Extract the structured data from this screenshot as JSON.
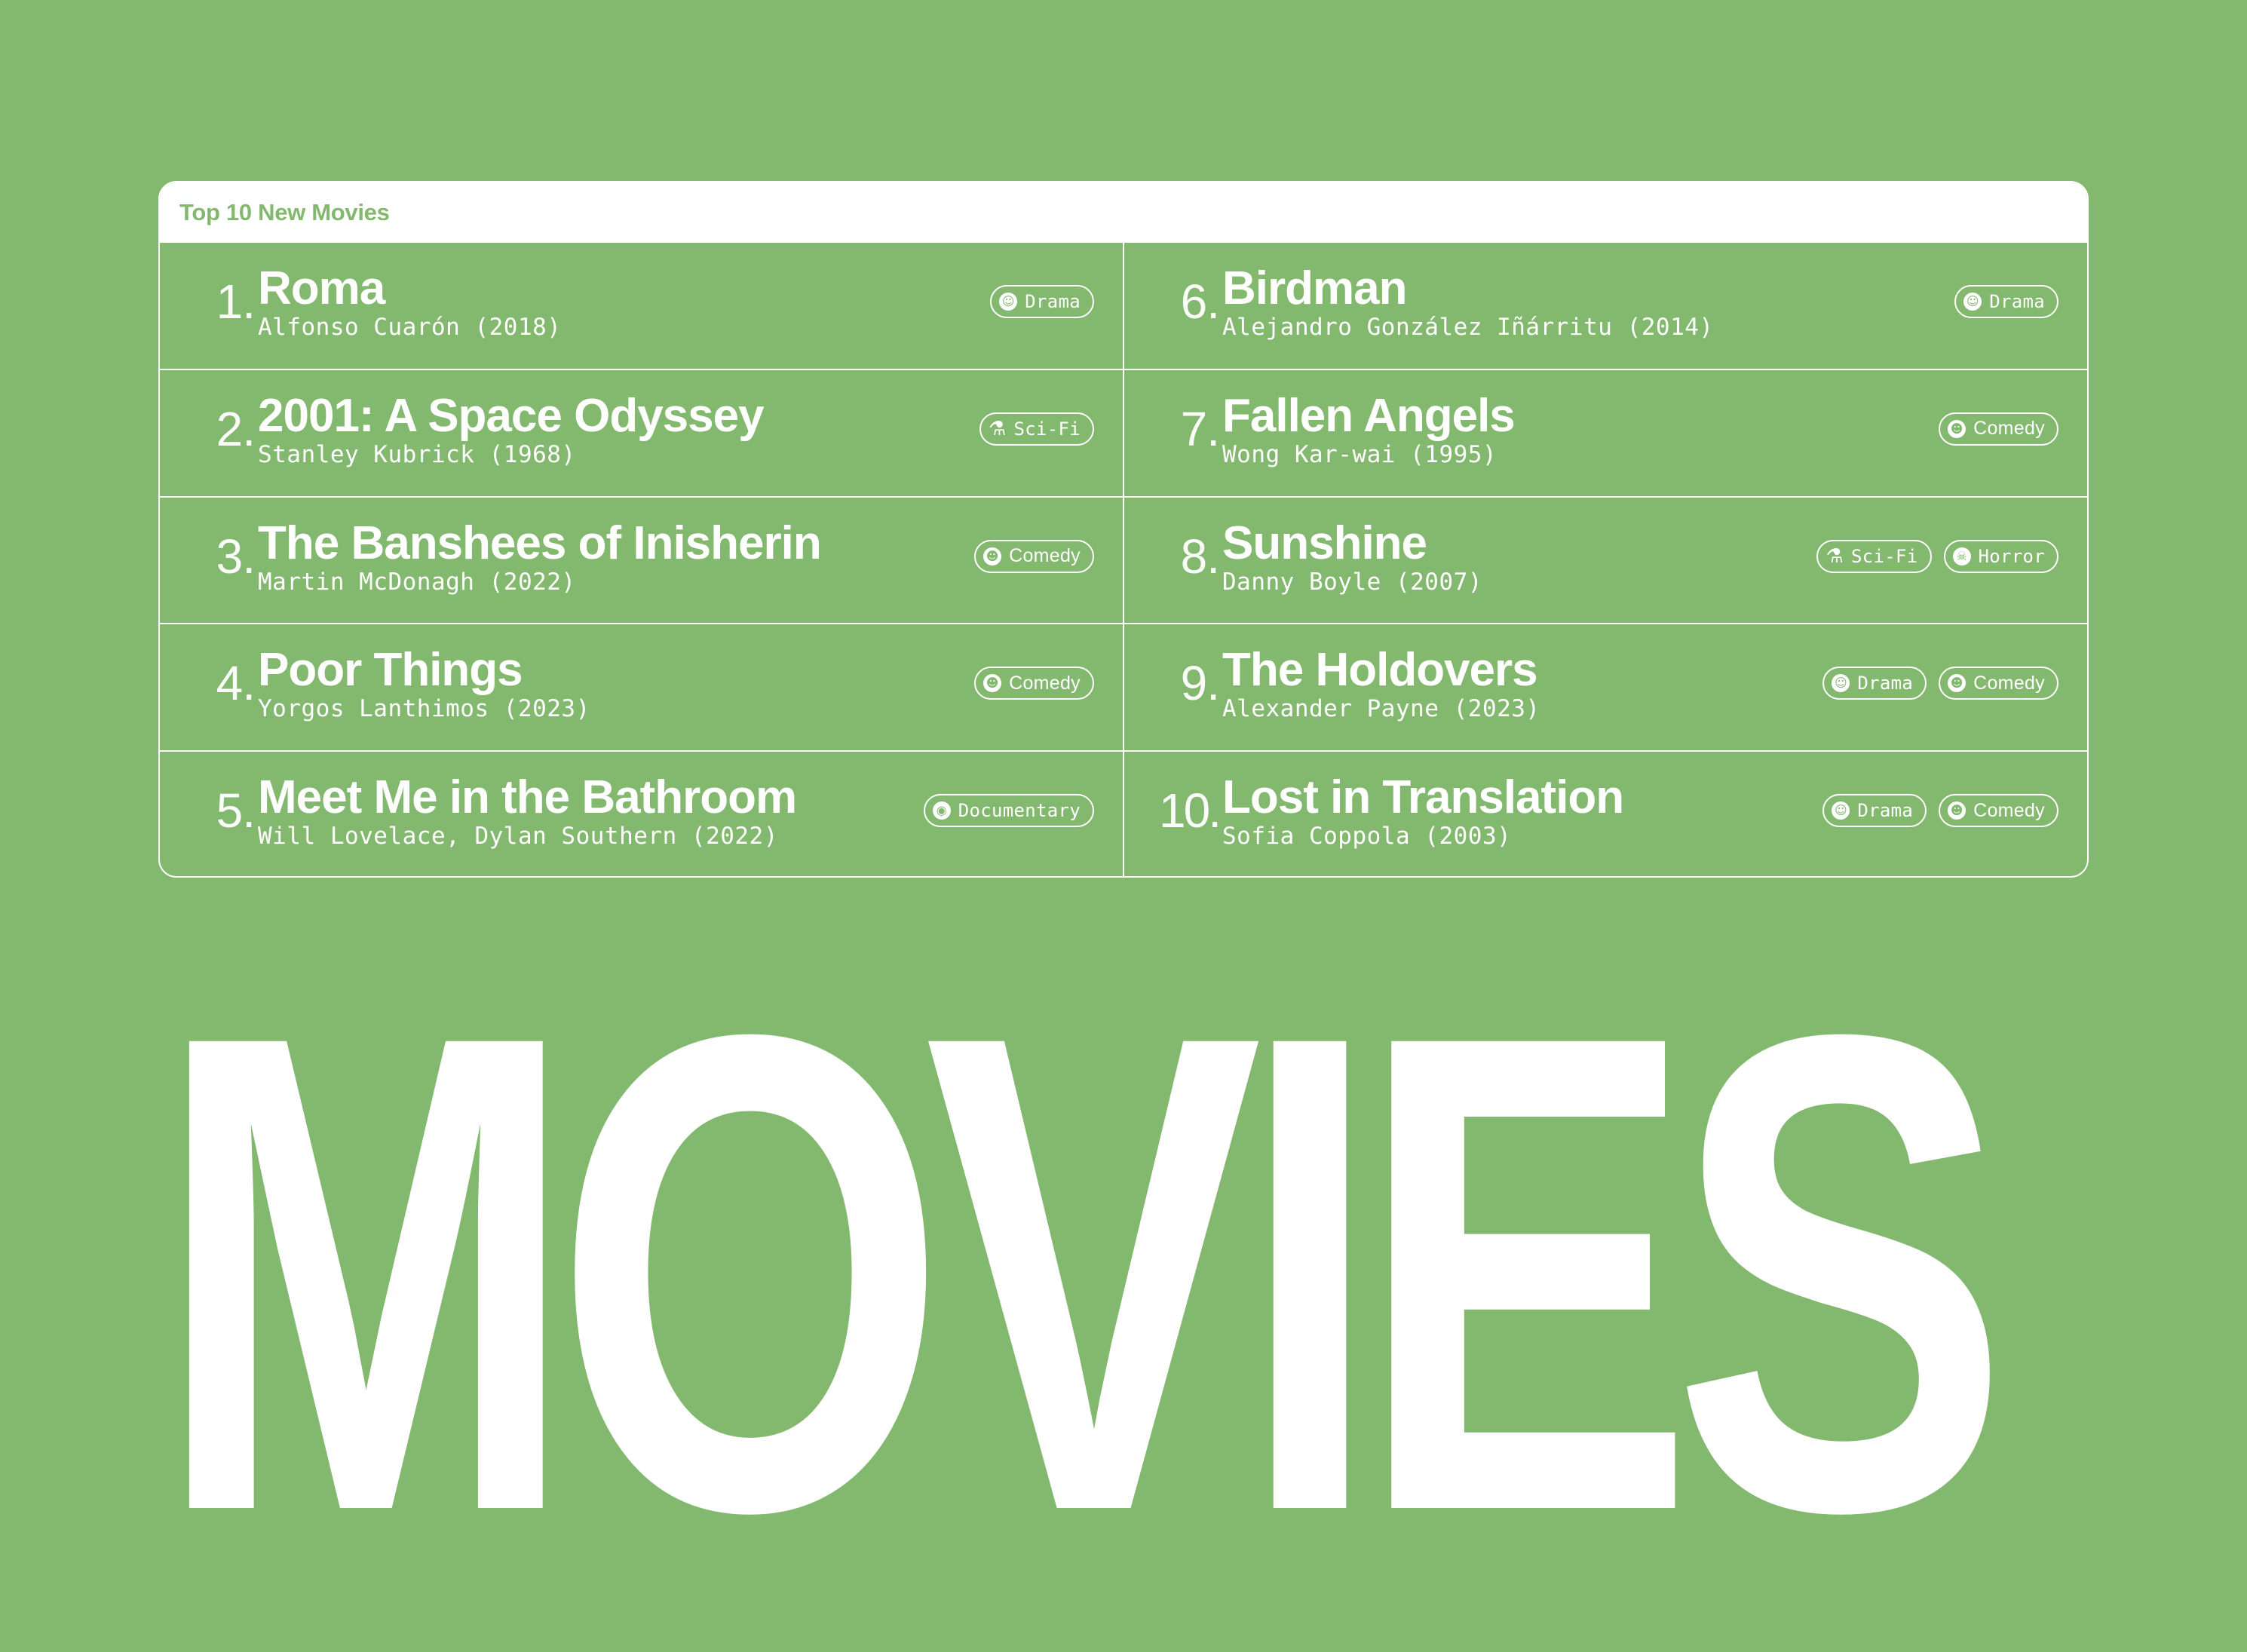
{
  "card": {
    "title": "Top 10 New Movies"
  },
  "movies": [
    {
      "rank": "1.",
      "title": "Roma",
      "meta": "Alfonso Cuarón (2018)",
      "tags": [
        {
          "label": "Drama",
          "icon": "drama-icon"
        }
      ]
    },
    {
      "rank": "2.",
      "title": "2001: A Space Odyssey",
      "meta": "Stanley Kubrick (1968)",
      "tags": [
        {
          "label": "Sci-Fi",
          "icon": "flask-icon"
        }
      ]
    },
    {
      "rank": "3.",
      "title": "The Banshees of Inisherin",
      "meta": "Martin McDonagh (2022)",
      "tags": [
        {
          "label": "Comedy",
          "icon": "smile-icon"
        }
      ]
    },
    {
      "rank": "4.",
      "title": "Poor Things",
      "meta": "Yorgos Lanthimos (2023)",
      "tags": [
        {
          "label": "Comedy",
          "icon": "smile-icon"
        }
      ]
    },
    {
      "rank": "5.",
      "title": "Meet Me in the Bathroom",
      "meta": "Will Lovelace, Dylan Southern (2022)",
      "tags": [
        {
          "label": "Documentary",
          "icon": "globe-icon"
        }
      ]
    },
    {
      "rank": "6.",
      "title": "Birdman",
      "meta": "Alejandro González Iñárritu (2014)",
      "tags": [
        {
          "label": "Drama",
          "icon": "drama-icon"
        }
      ]
    },
    {
      "rank": "7.",
      "title": "Fallen Angels",
      "meta": "Wong Kar-wai (1995)",
      "tags": [
        {
          "label": "Comedy",
          "icon": "smile-icon"
        }
      ]
    },
    {
      "rank": "8.",
      "title": "Sunshine",
      "meta": "Danny Boyle (2007)",
      "tags": [
        {
          "label": "Sci-Fi",
          "icon": "flask-icon"
        },
        {
          "label": "Horror",
          "icon": "skull-icon"
        }
      ]
    },
    {
      "rank": "9.",
      "title": "The Holdovers",
      "meta": "Alexander Payne (2023)",
      "tags": [
        {
          "label": "Drama",
          "icon": "drama-icon"
        },
        {
          "label": "Comedy",
          "icon": "smile-icon"
        }
      ]
    },
    {
      "rank": "10.",
      "title": "Lost in Translation",
      "meta": "Sofia Coppola (2003)",
      "tags": [
        {
          "label": "Drama",
          "icon": "drama-icon"
        },
        {
          "label": "Comedy",
          "icon": "smile-icon"
        }
      ]
    }
  ],
  "hero": {
    "text": "MOVIES"
  },
  "colors": {
    "background": "#83b86f",
    "foreground": "#ffffff"
  }
}
